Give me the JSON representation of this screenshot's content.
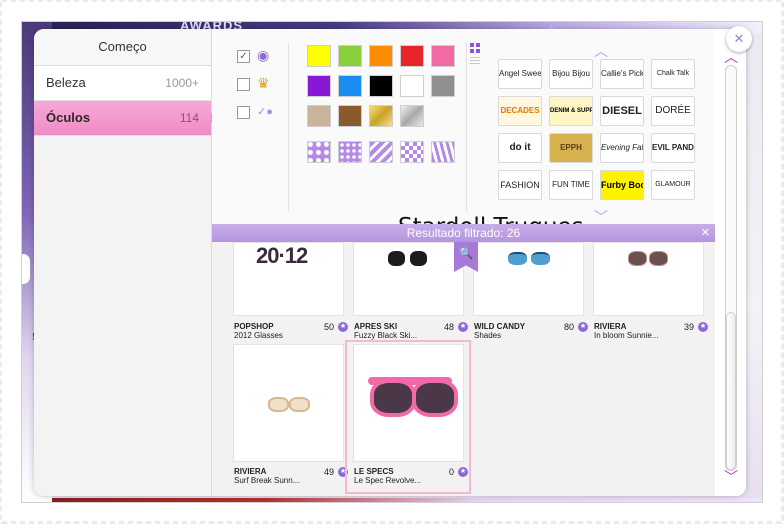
{
  "background": {
    "top_text": "AWARDS",
    "side_text": "5"
  },
  "panel": {
    "close_label": "✕",
    "overlay_title": "Stardoll Truques"
  },
  "sidebar": {
    "header": "Começo",
    "items": [
      {
        "label": "Beleza",
        "count": "1000+"
      },
      {
        "label": "Óculos",
        "count": "114"
      }
    ]
  },
  "filters": {
    "swatch_colors": [
      "#ffff00",
      "#88d13b",
      "#ff8c00",
      "#e8262a",
      "#f26aa5",
      "#8a17d4",
      "#1a8ef0",
      "#000000",
      "#ffffff",
      "#8f8f8f",
      "#c8b49a",
      "#8a5a2a"
    ],
    "brands": [
      "Angel Sweet",
      "Bijou Bijou",
      "Callie's Picks",
      "Chalk Talk",
      "DECADES",
      "DENIM & SUPPLY",
      "DIESEL",
      "DORÉE",
      "do it",
      "EPPH",
      "Evening Falls",
      "EVIL PANDA",
      "FASHION",
      "FUN TIME",
      "Furby Boom!",
      "GLAMOUR"
    ]
  },
  "results": {
    "label": "Resultado filtrado: 26",
    "close_label": "✕"
  },
  "items": [
    {
      "brand": "POPSHOP",
      "name": "2012 Glasses",
      "price": "50"
    },
    {
      "brand": "APRES SKI",
      "name": "Fuzzy Black Ski...",
      "price": "48"
    },
    {
      "brand": "WILD CANDY",
      "name": "Shades",
      "price": "80"
    },
    {
      "brand": "RIVIERA",
      "name": "In bloom Sunnie...",
      "price": "39"
    },
    {
      "brand": "RIVIERA",
      "name": "Surf Break Sunn...",
      "price": "49"
    },
    {
      "brand": "LE SPECS",
      "name": "Le Spec Revolve...",
      "price": "0"
    }
  ],
  "colors": {
    "accent_pink": "#ef8cc6",
    "accent_purple": "#b495e0"
  }
}
